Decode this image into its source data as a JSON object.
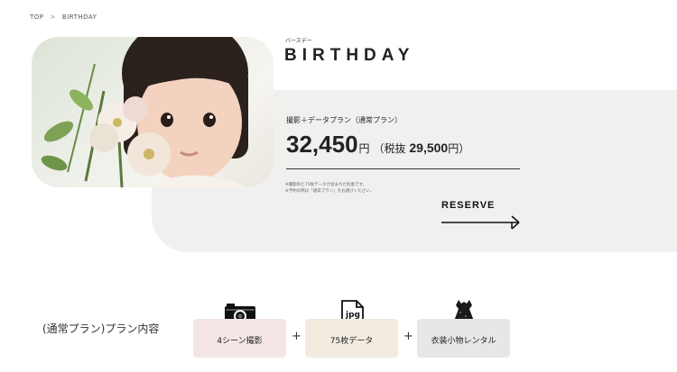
{
  "breadcrumb": {
    "home": "TOP",
    "separator": ">",
    "current": "BIRTHDAY"
  },
  "hero": {
    "ruby": "バースデー",
    "title": "BIRTHDAY",
    "plan_name": "撮影＋データプラン（通常プラン）",
    "price": "32,450",
    "price_unit": "円",
    "tax_prefix": "（税抜 ",
    "tax_price": "29,500",
    "tax_suffix": "円）",
    "note_1": "※撮影料と75枚データが含まれた料金です。",
    "note_2": "※予約の際は「通常プラン」をお選びください。",
    "reserve_label": "RESERVE"
  },
  "plan_contents": {
    "title": "(通常プラン)プラン内容",
    "items": [
      {
        "label": "4シーン撮影",
        "icon": "camera-icon"
      },
      {
        "label": "75枚データ",
        "icon": "jpg-file-icon"
      },
      {
        "label": "衣装小物レンタル",
        "icon": "dress-icon"
      }
    ],
    "plus": "+"
  },
  "colors": {
    "panel": "#f0f0ef",
    "card_1": "#f3e6e5",
    "card_2": "#f1ebe0",
    "card_3": "#e5e8e6"
  }
}
